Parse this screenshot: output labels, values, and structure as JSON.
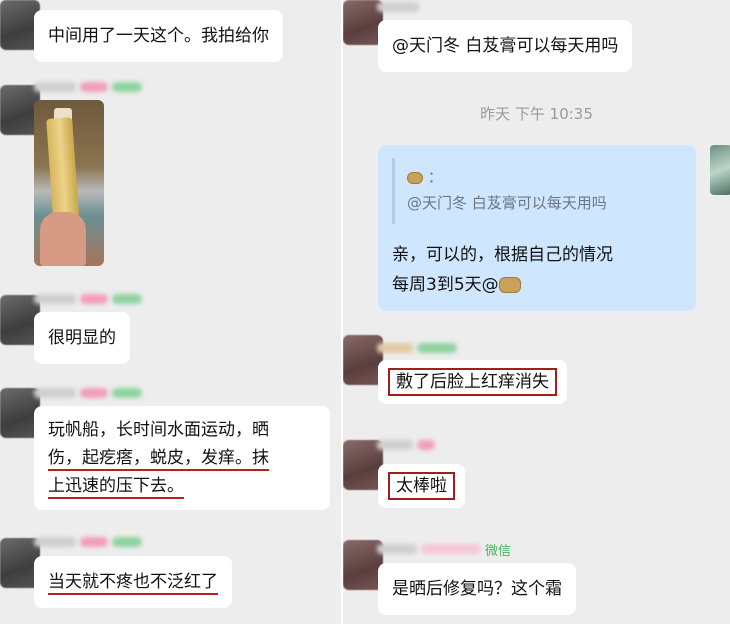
{
  "left": {
    "msg1": "中间用了一天这个。我拍给你",
    "msg2": "很明显的",
    "msg3_lines": [
      "玩帆船，长时间水面运动，晒",
      "伤，起疙瘩，蜕皮，发痒。抹",
      "上迅速的压下去。"
    ],
    "msg4": "当天就不疼也不泛红了"
  },
  "right": {
    "top_msg": "@天门冬 白芨膏可以每天用吗",
    "timestamp": "昨天 下午 10:35",
    "quote_colon": "：",
    "quote_text": "@天门冬 白芨膏可以每天用吗",
    "reply_line1": "亲，可以的，根据自己的情况",
    "reply_line2": "每周3到5天@",
    "msg_a": "敷了后脸上红痒消失",
    "msg_b": "太棒啦",
    "wechat_tag": "微信",
    "msg_c": "是晒后修复吗？这个霜"
  },
  "icons": [
    "avatar",
    "product-photo",
    "peanut-emoji"
  ],
  "colors": {
    "background": "#ededed",
    "bubble": "#ffffff",
    "self_bubble": "#cfe6ff",
    "annotation": "#a31d1d",
    "wechat": "#3bb862"
  }
}
